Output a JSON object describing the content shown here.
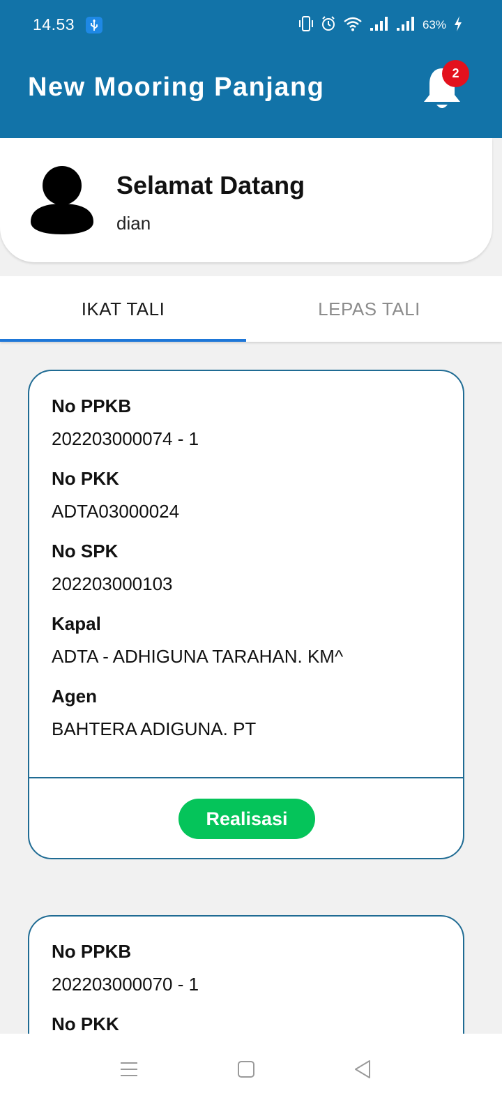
{
  "status_bar": {
    "time": "14.53",
    "battery_percent": "63%",
    "icons": [
      "usb-icon",
      "vibrate-icon",
      "alarm-icon",
      "wifi-icon",
      "signal-icon",
      "signal-icon",
      "charging-icon"
    ]
  },
  "app_bar": {
    "title": "New Mooring Panjang",
    "notification_count": "2",
    "background_color": "#1273a8"
  },
  "welcome": {
    "title": "Selamat Datang",
    "username": "dian"
  },
  "tabs": [
    {
      "label": "IKAT TALI",
      "active": true
    },
    {
      "label": "LEPAS TALI",
      "active": false
    }
  ],
  "cards": [
    {
      "fields": [
        {
          "label": "No PPKB",
          "value": "202203000074 - 1"
        },
        {
          "label": "No PKK",
          "value": "ADTA03000024"
        },
        {
          "label": "No SPK",
          "value": "202203000103"
        },
        {
          "label": "Kapal",
          "value": "ADTA - ADHIGUNA TARAHAN. KM^"
        },
        {
          "label": "Agen",
          "value": "BAHTERA ADIGUNA. PT"
        }
      ],
      "action_label": "Realisasi"
    },
    {
      "fields": [
        {
          "label": "No PPKB",
          "value": "202203000070 - 1"
        },
        {
          "label": "No PKK",
          "value": ""
        }
      ]
    }
  ],
  "colors": {
    "accent": "#1e77d8",
    "card_border": "#1f6b93",
    "action_button": "#05c45a",
    "badge": "#e3111d"
  }
}
